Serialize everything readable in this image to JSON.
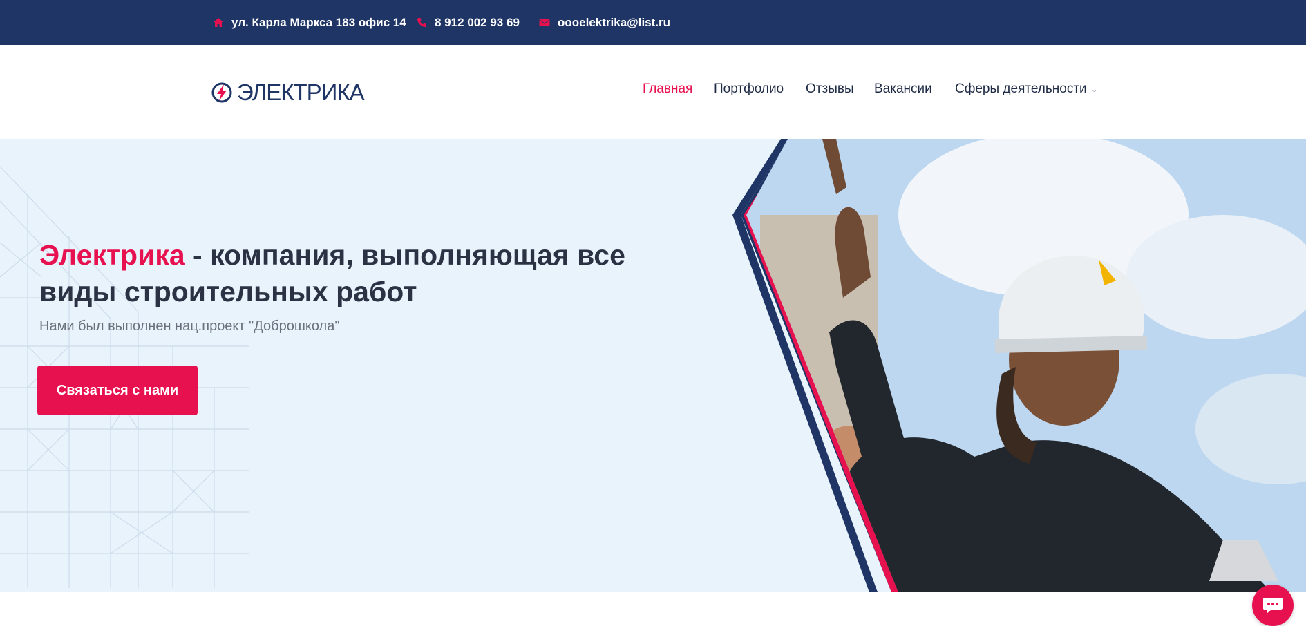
{
  "topbar": {
    "address": "ул. Карла Маркса 183 офис 14",
    "phone": "8 912 002 93 69",
    "email": "oooelektrika@list.ru",
    "icons": [
      "home-icon",
      "phone-icon",
      "envelope-icon"
    ]
  },
  "header": {
    "logo_text": "ЭЛЕКТРИКА",
    "nav": [
      {
        "label": "Главная",
        "active": true
      },
      {
        "label": "Портфолио",
        "active": false
      },
      {
        "label": "Отзывы",
        "active": false
      },
      {
        "label": "Вакансии",
        "active": false
      },
      {
        "label": "Сферы деятельности",
        "active": false,
        "dropdown": true
      }
    ]
  },
  "hero": {
    "brand": "Электрика",
    "headline_rest": " - компания, выполняющая все виды строительных работ",
    "subtext": "Нами был выполнен нац.проект \"Доброшкола\"",
    "cta_label": "Связаться с нами"
  },
  "colors": {
    "navy": "#1f3566",
    "accent": "#e8114f",
    "hero_bg": "#e8f3fc",
    "text_dark": "#2a3243"
  },
  "chat": {
    "icon": "chat-bubble-icon"
  }
}
